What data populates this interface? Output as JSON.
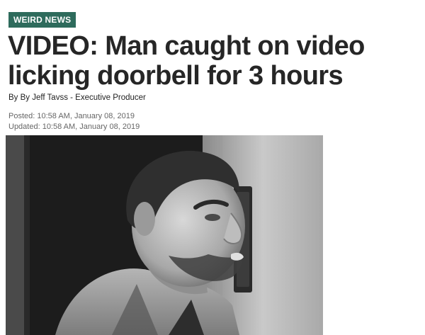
{
  "section_badge": "WEIRD NEWS",
  "headline": "VIDEO: Man caught on video licking doorbell for 3 hours",
  "byline": "By By Jeff Tavss - Executive Producer",
  "posted": "Posted: 10:58 AM, January 08, 2019",
  "updated": "Updated: 10:58 AM, January 08, 2019",
  "photo": {
    "subject": "grayscale doorbell camera still of a man licking a doorbell"
  },
  "colors": {
    "badge_bg": "#2e6b5c",
    "headline": "#262626",
    "meta": "#666666"
  }
}
